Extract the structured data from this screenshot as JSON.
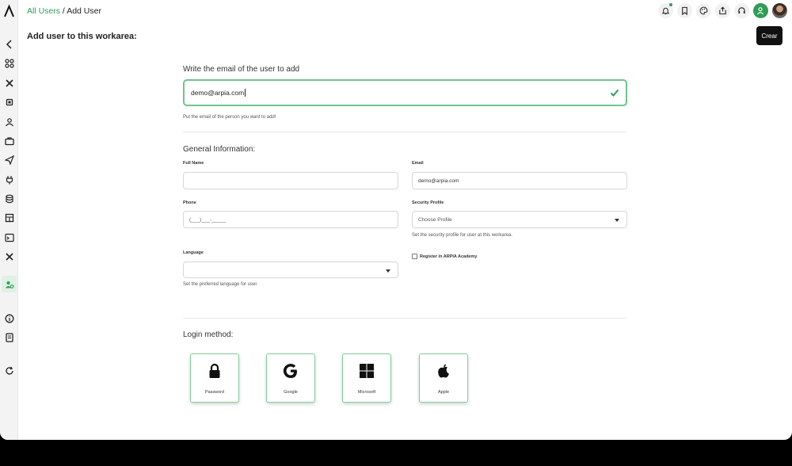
{
  "breadcrumb": {
    "link": "All Users",
    "separator": " / ",
    "current": "Add User"
  },
  "page": {
    "title": "Add user to this workarea:",
    "create_button": "Crear"
  },
  "email_section": {
    "label": "Write the email of the user to add",
    "value": "demo@arpia.com",
    "helper": "Put the email of the person you want to add!"
  },
  "general": {
    "title": "General Information:",
    "full_name": {
      "label": "Full Name",
      "value": ""
    },
    "email": {
      "label": "Email",
      "value": "demo@arpia.com"
    },
    "phone": {
      "label": "Phone",
      "placeholder": "(___)___-_____"
    },
    "security_profile": {
      "label": "Security Profile",
      "value": "Choose Profile",
      "helper": "Set the security profile for user at this workarea."
    },
    "language": {
      "label": "Language",
      "value": "",
      "helper": "Set the preferred language for user."
    },
    "academy_checkbox": {
      "label": "Register in ARPIA Academy",
      "checked": false
    }
  },
  "login": {
    "title": "Login method:",
    "methods": [
      {
        "label": "Password",
        "icon": "lock-icon"
      },
      {
        "label": "Google",
        "icon": "google-icon"
      },
      {
        "label": "Microsoft",
        "icon": "windows-icon"
      },
      {
        "label": "Apple",
        "icon": "apple-icon"
      }
    ]
  },
  "sidebar": {
    "items": [
      "back-icon",
      "apps-icon",
      "tools-icon",
      "chip-icon",
      "user-network-icon",
      "briefcase-icon",
      "send-icon",
      "plug-icon",
      "database-icon",
      "table-icon",
      "terminal-icon",
      "wrench-icon",
      "users-gear-icon",
      "info-icon",
      "book-icon",
      "refresh-icon"
    ]
  },
  "topbar": {
    "icons": [
      "bell-icon",
      "bookmark-icon",
      "palette-icon",
      "share-icon",
      "headset-icon",
      "user-add-icon"
    ]
  },
  "colors": {
    "accent": "#2f9d55",
    "input_focus": "#6cc58c"
  }
}
